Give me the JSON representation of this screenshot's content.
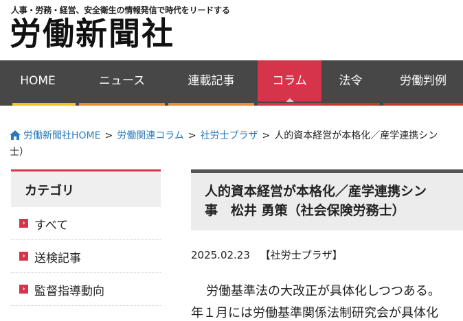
{
  "header": {
    "tagline": "人事・労務・経営、安全衛生の情報発信で時代をリードする",
    "logo": "労働新聞社"
  },
  "nav": {
    "items": [
      {
        "label": "HOME",
        "color": "#f0c419"
      },
      {
        "label": "ニュース",
        "color": "#ef8a2e"
      },
      {
        "label": "連載記事",
        "color": "#ef8a2e"
      },
      {
        "label": "コラム",
        "color": "#d5344a",
        "active": true
      },
      {
        "label": "法令",
        "color": "#c0392b"
      },
      {
        "label": "労働判例",
        "color": "#c0392b"
      }
    ]
  },
  "breadcrumb": {
    "items": [
      "労働新聞社HOME",
      "労働関連コラム",
      "社労士プラザ"
    ],
    "current": "人的資本経営が本格化／産学連携シン",
    "current_wrap": "士）",
    "separator": ">"
  },
  "sidebar": {
    "heading": "カテゴリ",
    "items": [
      {
        "label": "すべて"
      },
      {
        "label": "送検記事"
      },
      {
        "label": "監督指導動向"
      }
    ]
  },
  "article": {
    "title_line1": "人的資本経営が本格化／産学連携シン",
    "title_line2": "事　松井 勇策（社会保険労務士）",
    "date": "2025.02.23",
    "category": "【社労士プラザ】",
    "body_line1": "労働基準法の大改正が具体化しつつある。",
    "body_line2": "年１月には労働基準関係法制研究会が具体化"
  },
  "colors": {
    "accent": "#d5344a",
    "nav_bg": "#474747",
    "link": "#2a7bbd"
  }
}
